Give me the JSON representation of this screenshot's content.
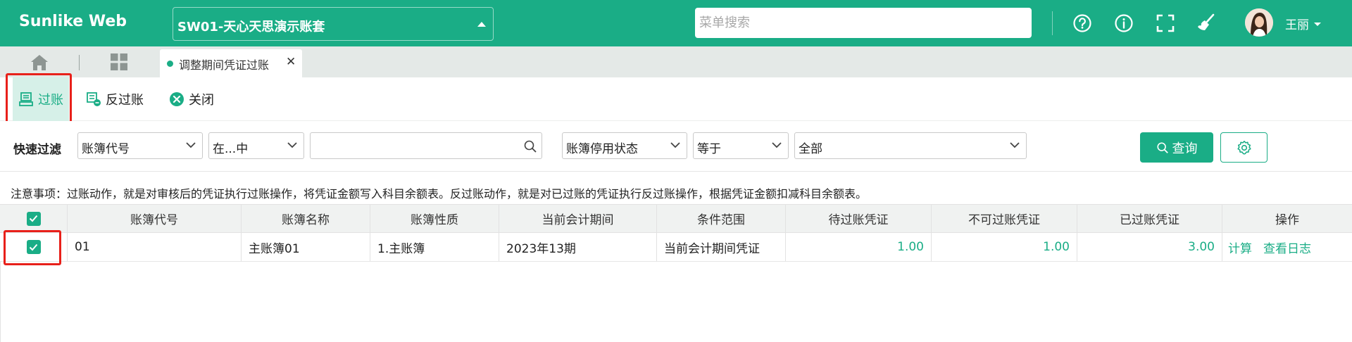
{
  "app": {
    "brand": "Sunlike Web"
  },
  "header": {
    "account_set": "SW01-天心天思演示账套",
    "search_placeholder": "菜单搜索",
    "username": "王丽"
  },
  "tabs": [
    {
      "label": "调整期间凭证过账"
    }
  ],
  "toolbar": {
    "post_label": "过账",
    "unpost_label": "反过账",
    "close_label": "关闭"
  },
  "filters": {
    "label": "快速过滤",
    "field1": "账簿代号",
    "operator1": "在...中",
    "value1": "",
    "field2": "账簿停用状态",
    "operator2": "等于",
    "value2": "全部",
    "query_label": "查询"
  },
  "notice": "注意事项：过账动作，就是对审核后的凭证执行过账操作，将凭证金额写入科目余额表。反过账动作，就是对已过账的凭证执行反过账操作，根据凭证金额扣减科目余额表。",
  "table": {
    "columns": [
      "账簿代号",
      "账簿名称",
      "账簿性质",
      "当前会计期间",
      "条件范围",
      "待过账凭证",
      "不可过账凭证",
      "已过账凭证",
      "操作"
    ],
    "rows": [
      {
        "code": "01",
        "name": "主账簿01",
        "nature": "1.主账簿",
        "period": "2023年13期",
        "scope": "当前会计期间凭证",
        "pending": "1.00",
        "unpostable": "1.00",
        "posted": "3.00",
        "actions": [
          "计算",
          "查看日志"
        ]
      }
    ]
  },
  "colors": {
    "brand": "#1aad86",
    "highlight_border": "#e8201a"
  },
  "icons": [
    "help-icon",
    "info-icon",
    "fullscreen-icon",
    "broom-icon",
    "home-icon",
    "grid-icon",
    "post-icon",
    "unpost-icon",
    "close-circle-icon",
    "chevron-down-icon",
    "search-icon",
    "settings-icon",
    "check-icon"
  ]
}
